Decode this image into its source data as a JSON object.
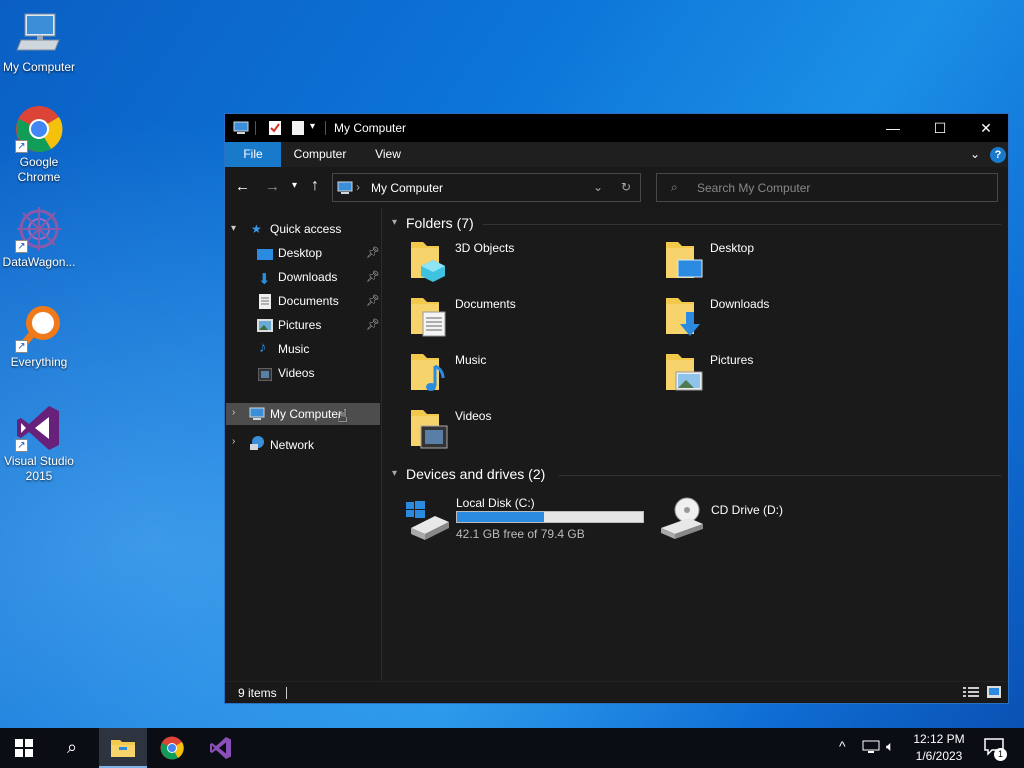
{
  "desktop": {
    "icons": [
      {
        "label": "My Computer"
      },
      {
        "label": "Google Chrome"
      },
      {
        "label": "DataWagon..."
      },
      {
        "label": "Everything"
      },
      {
        "label": "Visual Studio 2015"
      }
    ]
  },
  "window": {
    "title": "My Computer",
    "minimize_glyph": "—",
    "maximize_glyph": "☐",
    "close_glyph": "✕",
    "ribbon_tabs": [
      {
        "label": "File"
      },
      {
        "label": "Computer"
      },
      {
        "label": "View"
      }
    ],
    "address": {
      "separator": "›",
      "location": "My Computer"
    },
    "search": {
      "placeholder": "Search My Computer"
    },
    "nav": {
      "quick_access": "Quick access",
      "items": [
        {
          "label": "Desktop",
          "pinned": true
        },
        {
          "label": "Downloads",
          "pinned": true
        },
        {
          "label": "Documents",
          "pinned": true
        },
        {
          "label": "Pictures",
          "pinned": true
        },
        {
          "label": "Music",
          "pinned": false
        },
        {
          "label": "Videos",
          "pinned": false
        }
      ],
      "this_pc": "My Computer",
      "network": "Network"
    },
    "folders_group": "Folders (7)",
    "folders": [
      {
        "label": "3D Objects"
      },
      {
        "label": "Desktop"
      },
      {
        "label": "Documents"
      },
      {
        "label": "Downloads"
      },
      {
        "label": "Music"
      },
      {
        "label": "Pictures"
      },
      {
        "label": "Videos"
      }
    ],
    "devices_group": "Devices and drives (2)",
    "drives": [
      {
        "label": "Local Disk (C:)",
        "free_text": "42.1 GB free of 79.4 GB",
        "used_fraction": 0.47
      },
      {
        "label": "CD Drive (D:)"
      }
    ],
    "status": {
      "count": "9 items"
    }
  },
  "taskbar": {
    "time": "12:12 PM",
    "date": "1/6/2023",
    "notification_count": "1"
  },
  "colors": {
    "accent": "#1979ca",
    "folder_yellow": "#f2c94c",
    "drive_bar": "#2a8be0"
  }
}
